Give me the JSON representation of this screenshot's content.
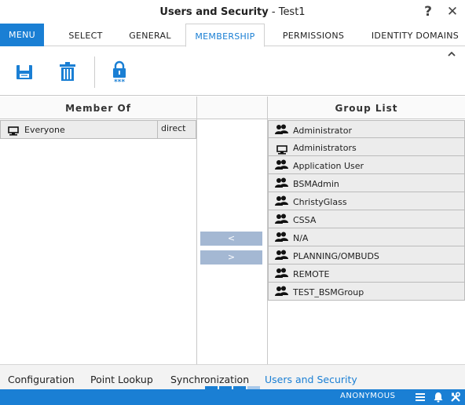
{
  "window": {
    "title_strong": "Users and Security",
    "title_rest": " - Test1",
    "help_label": "?",
    "close_label": "✕"
  },
  "tabbar": {
    "menu_label": "MENU",
    "tabs": [
      {
        "label": "SELECT",
        "active": false
      },
      {
        "label": "GENERAL",
        "active": false
      },
      {
        "label": "MEMBERSHIP",
        "active": true
      },
      {
        "label": "PERMISSIONS",
        "active": false
      },
      {
        "label": "IDENTITY DOMAINS",
        "active": false
      }
    ]
  },
  "toolbar": {
    "tools": [
      "save-icon",
      "delete-icon",
      "password-icon"
    ],
    "password_mask": "***",
    "collapse_icon": "chevron-up-icon"
  },
  "member_of": {
    "header": "Member Of",
    "rows": [
      {
        "name": "Everyone",
        "type": "direct",
        "icon": "computer-group-icon"
      }
    ]
  },
  "transfer": {
    "add_label": "<",
    "remove_label": ">"
  },
  "group_list": {
    "header": "Group List",
    "items": [
      {
        "name": "Administrator",
        "icon": "users-icon"
      },
      {
        "name": "Administrators",
        "icon": "computer-group-icon"
      },
      {
        "name": "Application User",
        "icon": "users-icon"
      },
      {
        "name": "BSMAdmin",
        "icon": "users-icon"
      },
      {
        "name": "ChristyGlass",
        "icon": "users-icon"
      },
      {
        "name": "CSSA",
        "icon": "users-icon"
      },
      {
        "name": "N/A",
        "icon": "users-icon"
      },
      {
        "name": "PLANNING/OMBUDS",
        "icon": "users-icon"
      },
      {
        "name": "REMOTE",
        "icon": "users-icon"
      },
      {
        "name": "TEST_BSMGroup",
        "icon": "users-icon"
      }
    ]
  },
  "bottomnav": {
    "items": [
      {
        "label": "Configuration",
        "active": false
      },
      {
        "label": "Point Lookup",
        "active": false
      },
      {
        "label": "Synchronization",
        "active": false
      },
      {
        "label": "Users and Security",
        "active": true
      }
    ]
  },
  "statusbar": {
    "user": "ANONYMOUS",
    "icons": [
      "menu-icon",
      "bell-icon",
      "tools-icon"
    ]
  },
  "colors": {
    "accent": "#1a7fd4",
    "button_disabled": "#a4b8d3",
    "row_bg": "#ececec"
  }
}
